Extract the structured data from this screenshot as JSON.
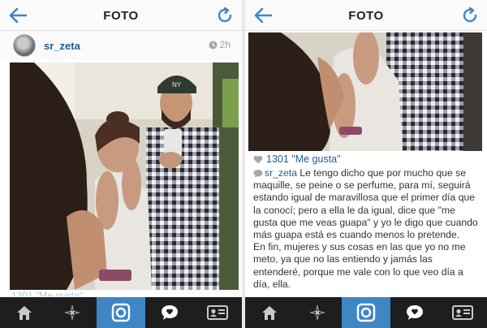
{
  "header": {
    "title": "FOTO"
  },
  "post": {
    "username": "sr_zeta",
    "time": "2h",
    "likes": "1301 \"Me gusta\"",
    "likes_partial": "1301 \"Me gusta\"",
    "caption_p1": "Le tengo dicho que por mucho que se maquille, se peine o se perfume, para mí, seguirá estando igual de maravillosa que el primer día que la conocí; pero a ella le da igual, dice que \"me gusta que me veas guapa\" y yo le digo que cuando más guapa está es cuando menos lo pretende.",
    "caption_p2": "En fin, mujeres y sus cosas en las que yo no me meto, ya que no las entiendo y jamás las entenderé, porque me vale con lo que veo día a día, ella.",
    "photo_cap_text": "NY"
  },
  "tabs": [
    {
      "name": "home",
      "icon": "home-icon"
    },
    {
      "name": "explore",
      "icon": "star-icon"
    },
    {
      "name": "camera",
      "icon": "camera-icon",
      "active": true
    },
    {
      "name": "activity",
      "icon": "speech-bubble-icon"
    },
    {
      "name": "profile",
      "icon": "profile-card-icon"
    }
  ],
  "colors": {
    "accent": "#3f86c4",
    "link": "#1d5d8c",
    "tab_bar": "#1e1e1e"
  }
}
